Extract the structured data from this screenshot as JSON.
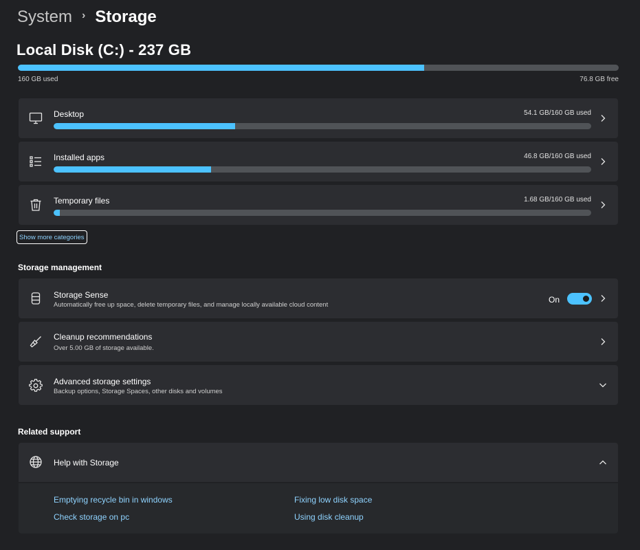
{
  "breadcrumb": {
    "parent": "System",
    "separator": "›",
    "current": "Storage"
  },
  "disk": {
    "title": "Local Disk (C:) - 237 GB",
    "used_label": "160 GB used",
    "free_label": "76.8 GB free",
    "used_fraction": 0.676,
    "accent_color": "#4cc2ff"
  },
  "categories": [
    {
      "label": "Desktop",
      "size": "54.1 GB/160 GB used",
      "fraction": 0.338,
      "icon": "monitor-icon"
    },
    {
      "label": "Installed apps",
      "size": "46.8 GB/160 GB used",
      "fraction": 0.293,
      "icon": "list-icon"
    },
    {
      "label": "Temporary files",
      "size": "1.68 GB/160 GB used",
      "fraction": 0.011,
      "icon": "trash-icon"
    }
  ],
  "show_more_label": "Show more categories",
  "storage_management": {
    "title": "Storage management",
    "storage_sense": {
      "title": "Storage Sense",
      "subtitle": "Automatically free up space, delete temporary files, and manage locally available cloud content",
      "toggle_label": "On",
      "toggle_on": true,
      "icon": "storage-drive-icon"
    },
    "cleanup": {
      "title": "Cleanup recommendations",
      "subtitle": "Over 5.00 GB of storage available.",
      "icon": "broom-icon"
    },
    "advanced": {
      "title": "Advanced storage settings",
      "subtitle": "Backup options, Storage Spaces, other disks and volumes",
      "icon": "gear-icon"
    }
  },
  "related_support": {
    "title": "Related support",
    "help": {
      "title": "Help with Storage",
      "icon": "globe-icon",
      "links": [
        "Emptying recycle bin in windows",
        "Fixing low disk space",
        "Check storage on pc",
        "Using disk cleanup"
      ]
    }
  }
}
